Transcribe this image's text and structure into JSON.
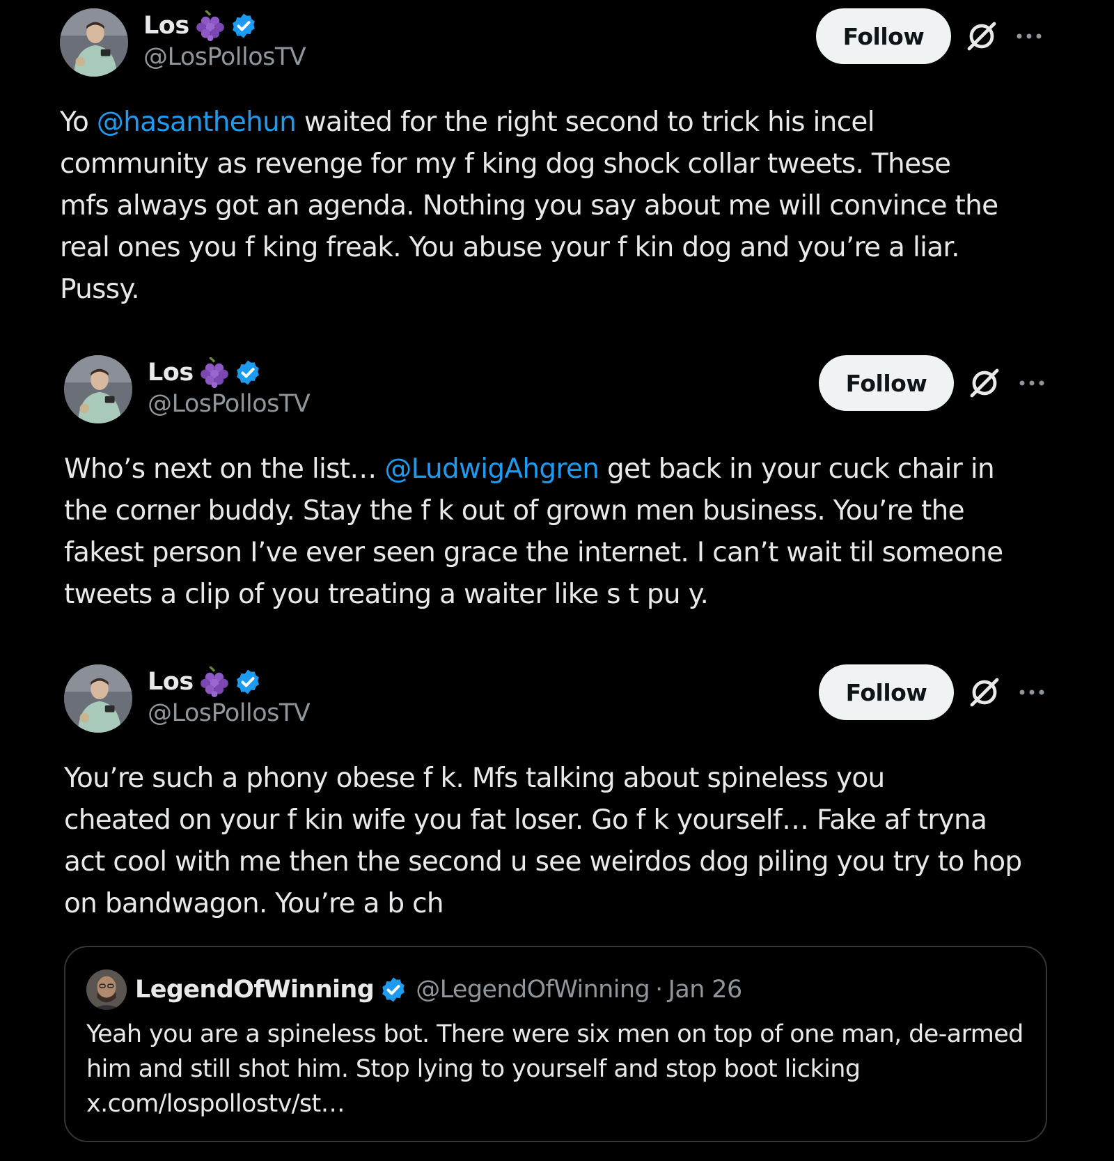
{
  "colors": {
    "background": "#000000",
    "text": "#e7e9ea",
    "secondary_text": "#8f969c",
    "mention": "#1d9bf0",
    "verified": "#1d9bf0",
    "follow_bg": "#eff3f4",
    "follow_text": "#0f1419",
    "border": "#333639"
  },
  "tweets": [
    {
      "display_name": "Los",
      "handle": "@LosPollosTV",
      "follow_label": "Follow",
      "badge_icons": [
        "grapes-icon",
        "verified-icon"
      ],
      "lines": [
        {
          "before": "Yo ",
          "mention": "@hasanthehun",
          "after": " waited for the right second to trick his incel"
        },
        {
          "before": "community as revenge for my f     king dog shock collar tweets. These",
          "mention": "",
          "after": ""
        },
        {
          "before": "mfs always got an agenda. Nothing you say about me will convince the",
          "mention": "",
          "after": ""
        },
        {
          "before": "real ones you f     king freak. You abuse your f     kin dog and you’re a liar.",
          "mention": "",
          "after": ""
        },
        {
          "before": "Pussy.",
          "mention": "",
          "after": ""
        }
      ]
    },
    {
      "display_name": "Los",
      "handle": "@LosPollosTV",
      "follow_label": "Follow",
      "badge_icons": [
        "grapes-icon",
        "verified-icon"
      ],
      "lines": [
        {
          "before": "Who’s next on the list… ",
          "mention": "@LudwigAhgren",
          "after": " get back in your cuck chair in"
        },
        {
          "before": "the corner buddy. Stay the f     k out of grown men business. You’re the",
          "mention": "",
          "after": ""
        },
        {
          "before": "fakest person I’ve ever seen grace the internet. I can’t wait til someone",
          "mention": "",
          "after": ""
        },
        {
          "before": "tweets a clip of you treating a waiter like s     t pu     y.",
          "mention": "",
          "after": ""
        }
      ]
    },
    {
      "display_name": "Los",
      "handle": "@LosPollosTV",
      "follow_label": "Follow",
      "badge_icons": [
        "grapes-icon",
        "verified-icon"
      ],
      "lines": [
        {
          "before": "You’re such a phony obese f     k. Mfs talking about spineless you",
          "mention": "",
          "after": ""
        },
        {
          "before": "cheated on your f     kin wife you fat loser. Go f     k yourself… Fake af tryna",
          "mention": "",
          "after": ""
        },
        {
          "before": "act cool with me then the second u see weirdos dog piling you try to hop",
          "mention": "",
          "after": ""
        },
        {
          "before": "on bandwagon. You’re a b   ch",
          "mention": "",
          "after": ""
        }
      ],
      "quote": {
        "display_name": "LegendOfWinning",
        "handle": "@LegendOfWinning",
        "separator": "·",
        "date": "Jan 26",
        "lines": [
          "Yeah you are a spineless bot. There were six men on top of one man, de-armed",
          "him and still shot him. Stop lying to yourself and stop boot licking",
          "x.com/lospollostv/st…"
        ]
      }
    }
  ]
}
